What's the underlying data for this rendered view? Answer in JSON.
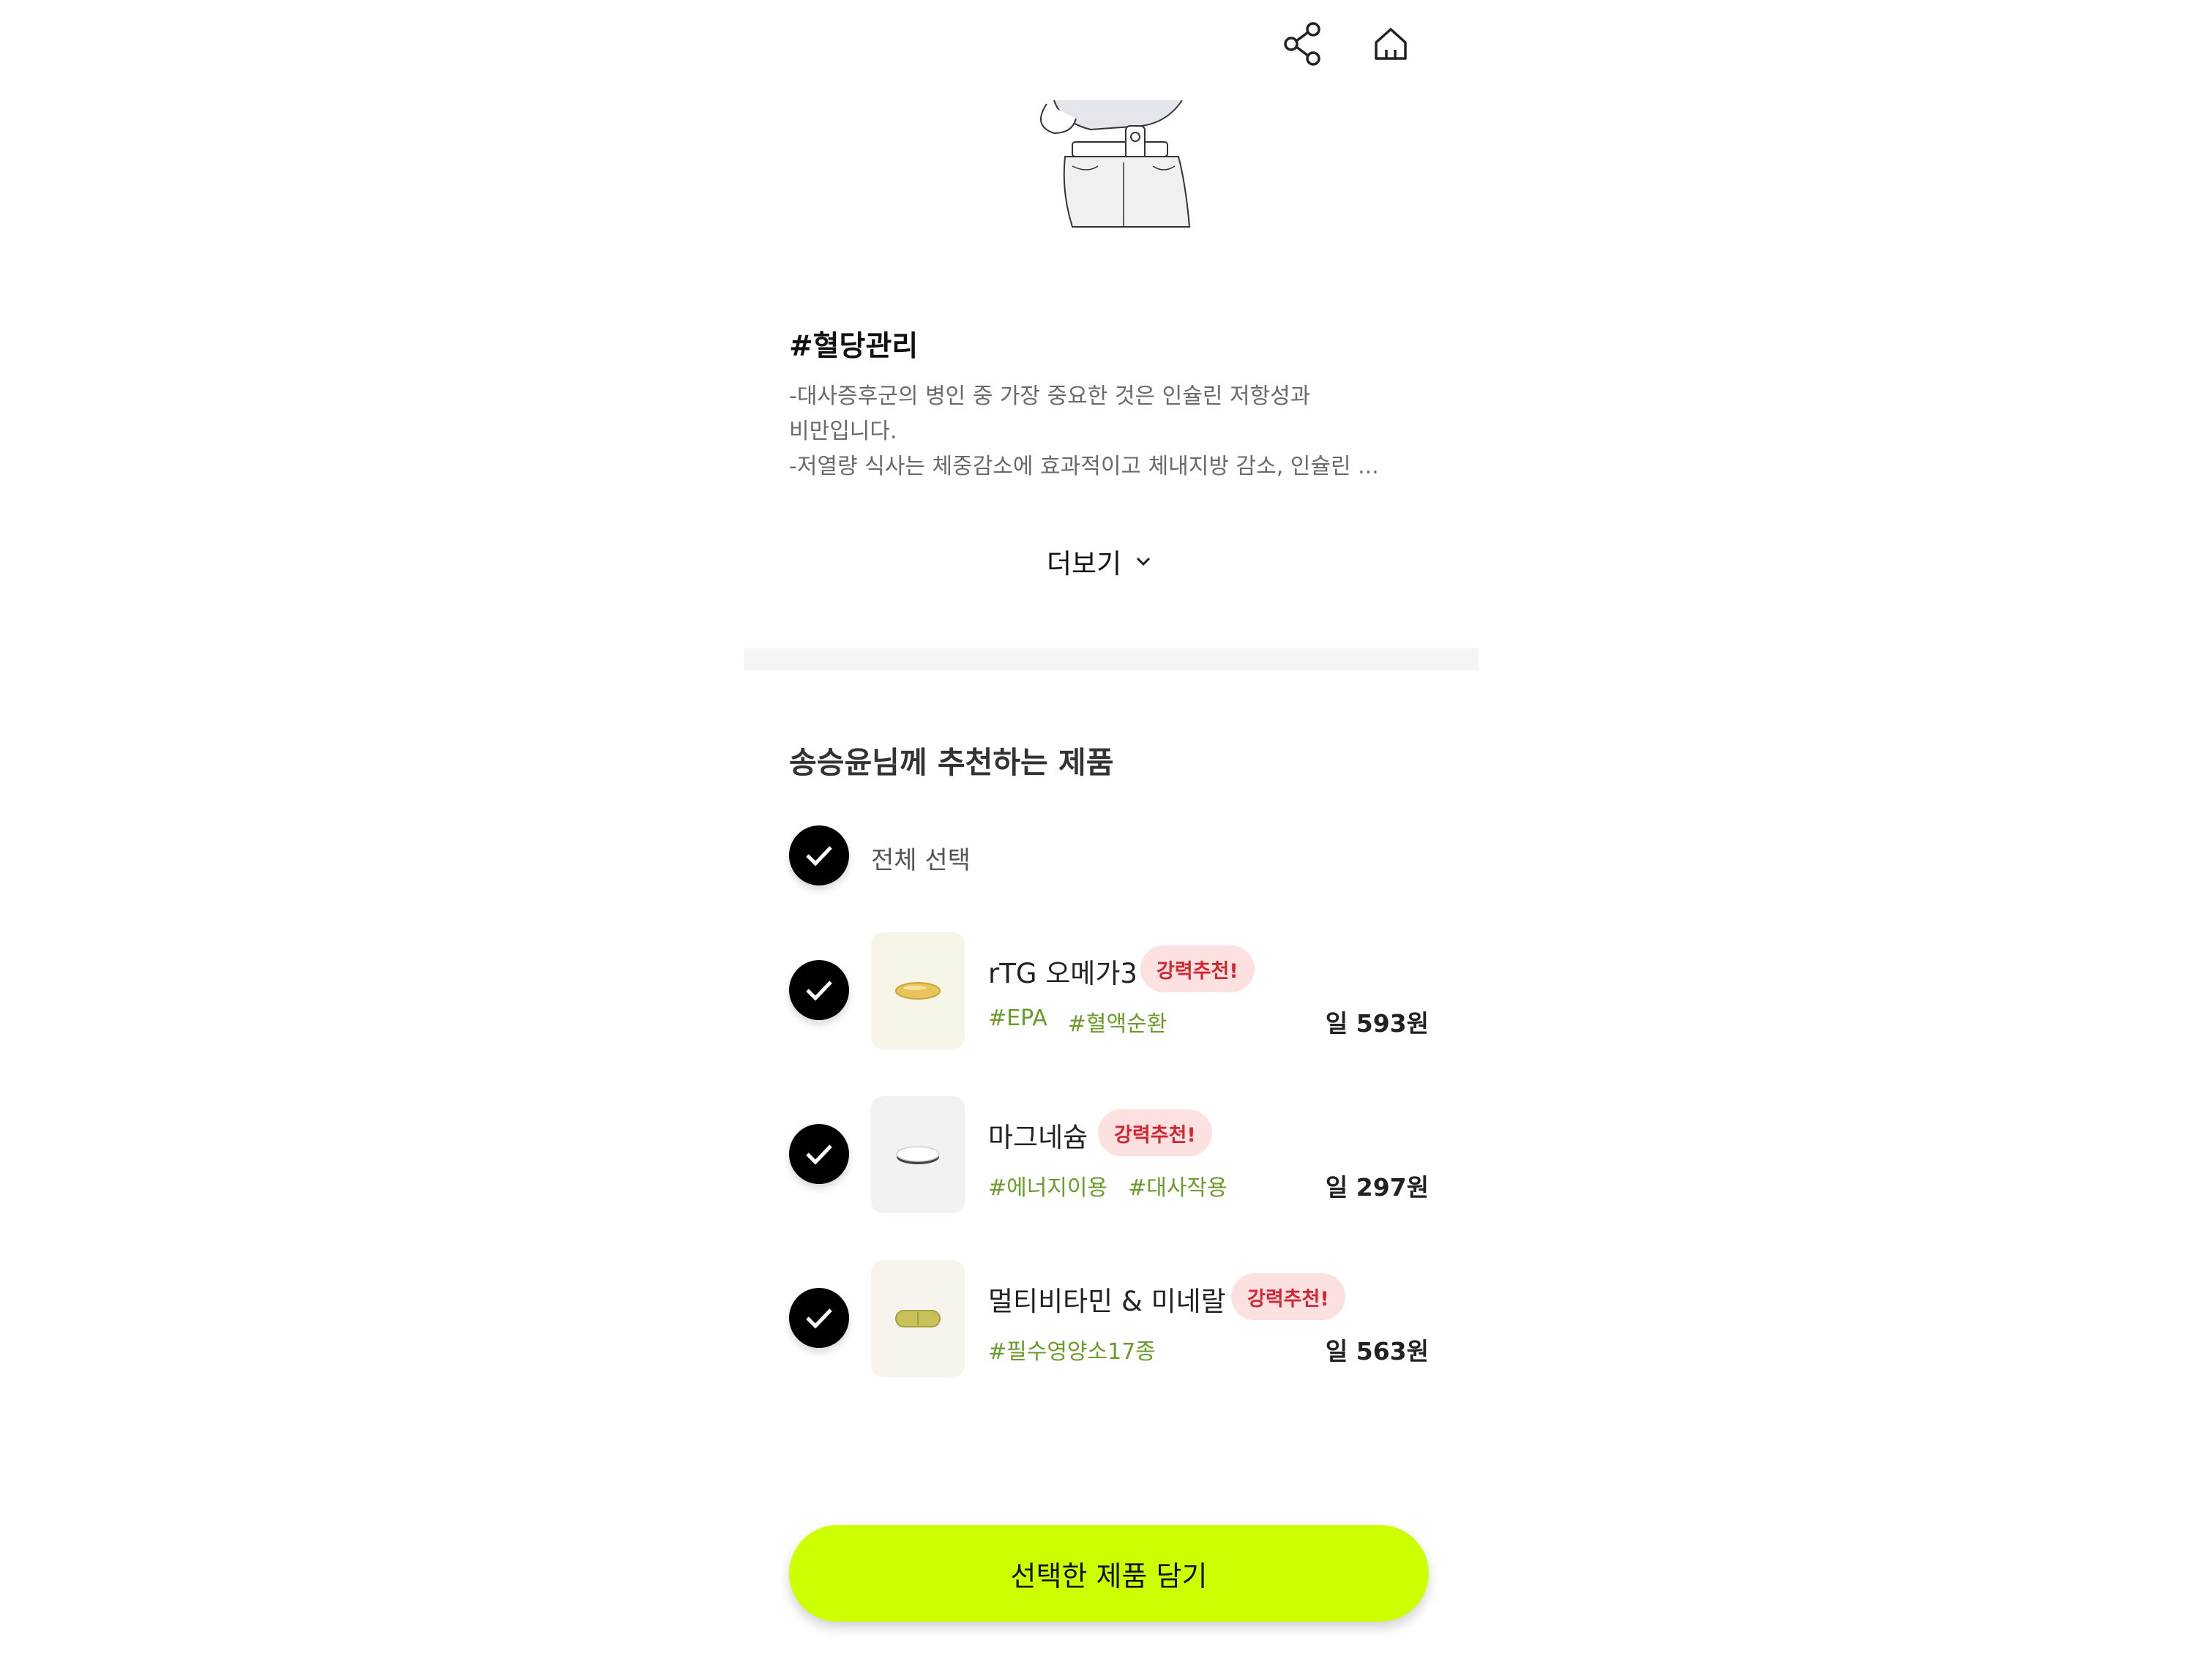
{
  "header": {
    "share_icon": "share-icon",
    "home_icon": "home-icon"
  },
  "article": {
    "tag_title": "#혈당관리",
    "description_lines": [
      "-대사증후군의 병인 중 가장 중요한 것은 인슐린 저항성과",
      "비만입니다.",
      "-저열량 식사는 체중감소에 효과적이고 체내지방 감소, 인슐린 ..."
    ],
    "more_label": "더보기"
  },
  "recommend": {
    "title": "송승윤님께 추천하는 제품",
    "select_all_label": "전체 선택",
    "products": [
      {
        "name": "rTG 오메가3",
        "badge": "강력추천!",
        "tags": [
          "#EPA",
          "#혈액순환"
        ],
        "price": "일 593원",
        "thumb_bg": "#f6f5e8",
        "checked": true
      },
      {
        "name": "마그네슘",
        "badge": "강력추천!",
        "tags": [
          "#에너지이용",
          "#대사작용"
        ],
        "price": "일 297원",
        "thumb_bg": "#f2f2f2",
        "checked": true
      },
      {
        "name": "멀티비타민 & 미네랄",
        "badge": "강력추천!",
        "tags": [
          "#필수영양소17종"
        ],
        "price": "일 563원",
        "thumb_bg": "#f7f4ee",
        "checked": true
      }
    ]
  },
  "cta": {
    "label": "선택한 제품 담기",
    "color": "#ccff00"
  },
  "colors": {
    "accent": "#ccff00",
    "tag_green": "#6b9b2a",
    "badge_red": "#d02833",
    "badge_bg": "#fde0e0"
  }
}
